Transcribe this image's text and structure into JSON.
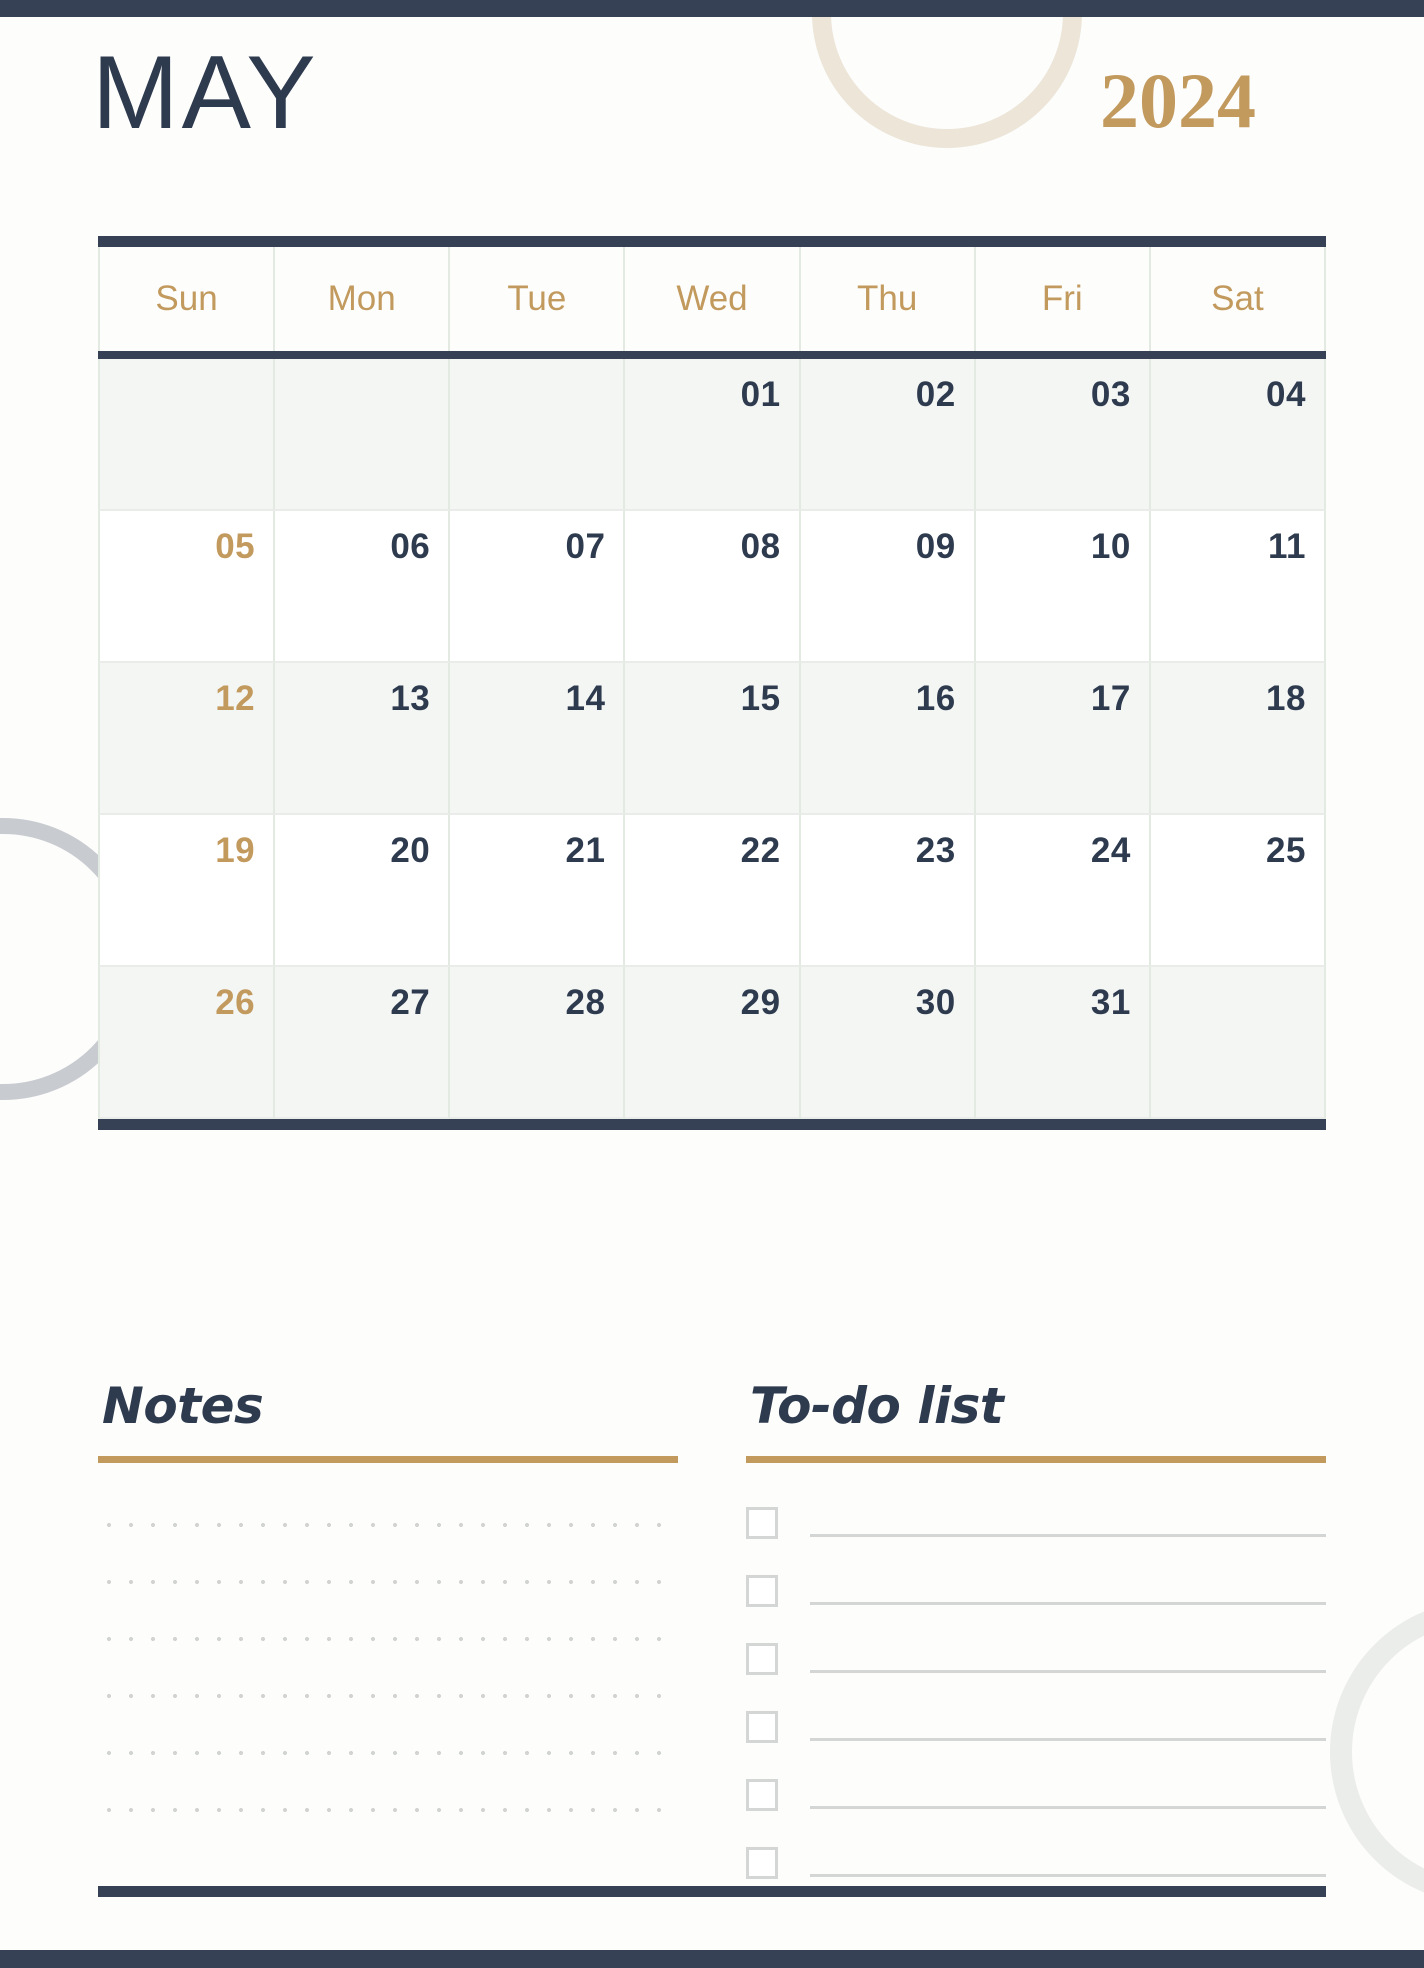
{
  "document": {
    "month": "MAY",
    "year": "2024"
  },
  "colors": {
    "navy": "#364156",
    "gold": "#c29a5e",
    "tint_row": "#f4f6f4",
    "grid_line": "#e3eae2",
    "cream_circle": "#ece5d8",
    "gray_circle": "#c8cbd0",
    "pale_circle": "#ebedea",
    "rule_gray": "#d4d6d5"
  },
  "calendar": {
    "weekdays": [
      "Sun",
      "Mon",
      "Tue",
      "Wed",
      "Thu",
      "Fri",
      "Sat"
    ],
    "weeks": [
      {
        "tinted": true,
        "days": [
          "",
          "",
          "",
          "01",
          "02",
          "03",
          "04"
        ]
      },
      {
        "tinted": false,
        "days": [
          "05",
          "06",
          "07",
          "08",
          "09",
          "10",
          "11"
        ]
      },
      {
        "tinted": true,
        "days": [
          "12",
          "13",
          "14",
          "15",
          "16",
          "17",
          "18"
        ]
      },
      {
        "tinted": false,
        "days": [
          "19",
          "20",
          "21",
          "22",
          "23",
          "24",
          "25"
        ]
      },
      {
        "tinted": true,
        "days": [
          "26",
          "27",
          "28",
          "29",
          "30",
          "31",
          ""
        ]
      }
    ]
  },
  "notes": {
    "title": "Notes",
    "line_count": 6
  },
  "todo": {
    "title": "To-do list",
    "item_count": 6,
    "items": [
      "",
      "",
      "",
      "",
      "",
      ""
    ]
  }
}
